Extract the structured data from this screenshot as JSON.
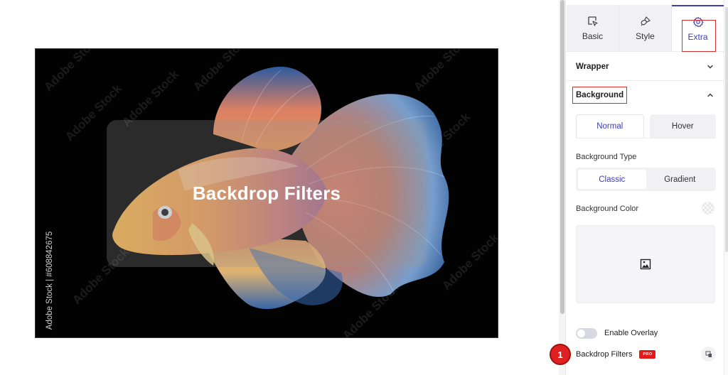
{
  "canvas": {
    "overlay_title": "Backdrop Filters",
    "stock_credit": "Adobe Stock | #608842675",
    "watermark_text": "Adobe Stock",
    "image_subject": "betta fish on black background"
  },
  "panel": {
    "tabs": [
      {
        "label": "Basic",
        "icon": "cursor-select-icon",
        "active": false
      },
      {
        "label": "Style",
        "icon": "paintbrush-icon",
        "active": false
      },
      {
        "label": "Extra",
        "icon": "gear-icon",
        "active": true,
        "highlighted": true
      }
    ],
    "sections": {
      "wrapper": {
        "title": "Wrapper",
        "expanded": false
      },
      "background": {
        "title": "Background",
        "expanded": true,
        "highlighted": true
      }
    },
    "state_tabs": [
      {
        "label": "Normal",
        "active": true
      },
      {
        "label": "Hover",
        "active": false
      }
    ],
    "background_type": {
      "label": "Background Type",
      "options": [
        {
          "label": "Classic",
          "active": true
        },
        {
          "label": "Gradient",
          "active": false
        }
      ]
    },
    "background_color": {
      "label": "Background Color"
    },
    "enable_overlay": {
      "label": "Enable Overlay",
      "enabled": false
    },
    "backdrop_filters": {
      "label": "Backdrop Filters",
      "badge": "PRO"
    }
  },
  "step_marker": {
    "number": "1"
  },
  "colors": {
    "accent": "#3b3fb0",
    "highlight_border": "#d32f2f",
    "pro_badge": "#e11b1b",
    "step_marker": "#e02020"
  }
}
